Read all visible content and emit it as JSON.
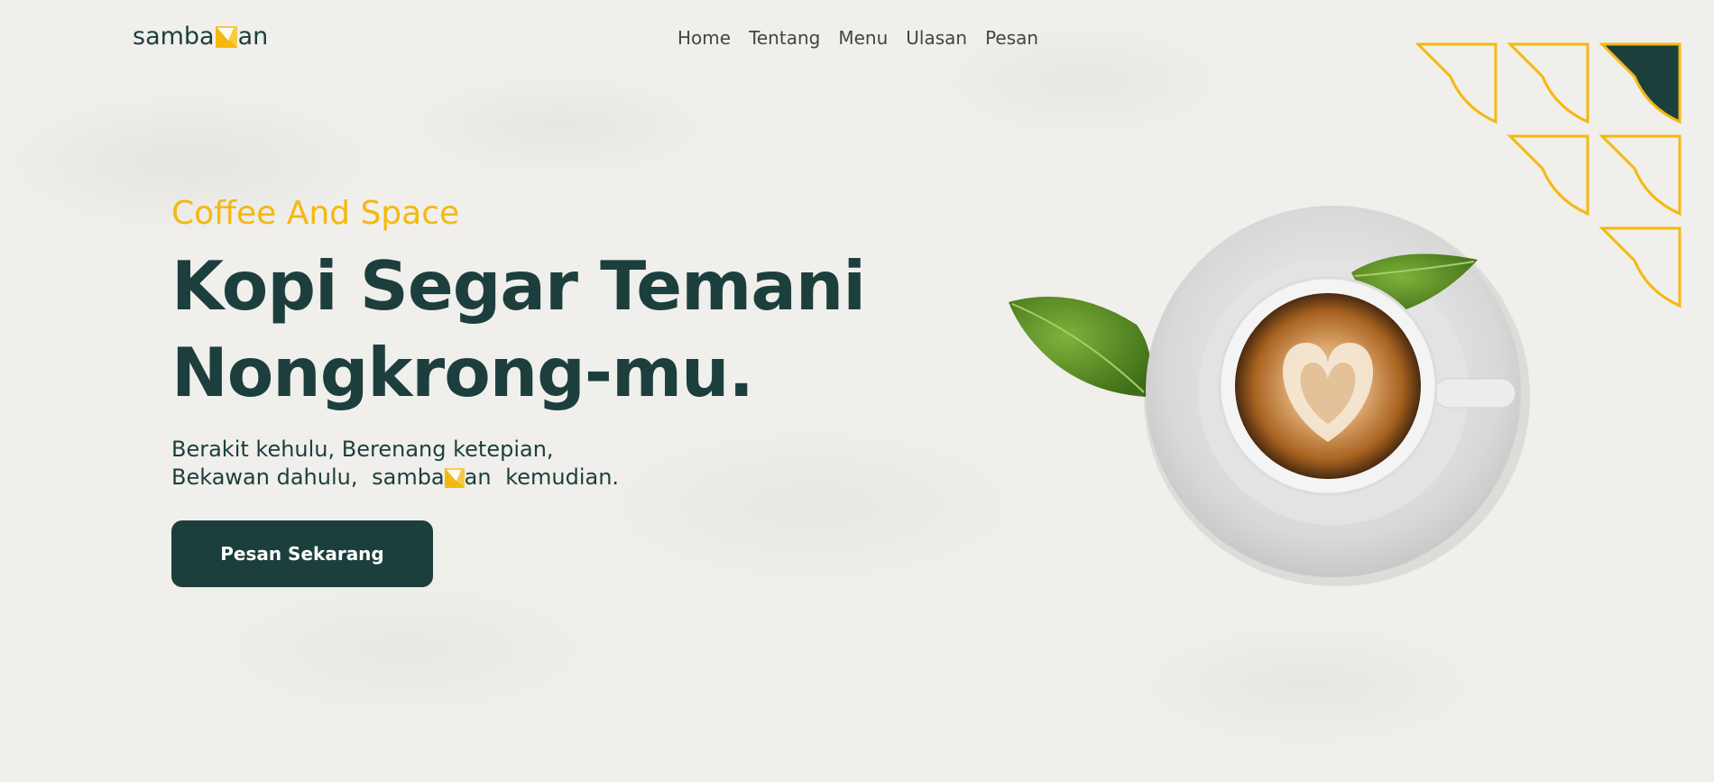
{
  "brand": {
    "name_part1": "samba",
    "name_part2": "an"
  },
  "nav": {
    "items": [
      "Home",
      "Tentang",
      "Menu",
      "Ulasan",
      "Pesan"
    ]
  },
  "hero": {
    "eyebrow": "Coffee And Space",
    "headline_line1": "Kopi Segar Temani",
    "headline_line2": "Nongkrong-mu.",
    "sub_line1": "Berakit kehulu, Berenang ketepian,",
    "sub_line2_prefix": "Bekawan dahulu,",
    "sub_line2_suffix": "kemudian.",
    "cta_label": "Pesan Sekarang"
  },
  "colors": {
    "accent": "#f5b80f",
    "primary": "#1c3f3d",
    "background": "#f0efeb"
  },
  "icons": {
    "logo_mark": "folded-corner-icon",
    "decor": "triangle-pattern-icon"
  }
}
